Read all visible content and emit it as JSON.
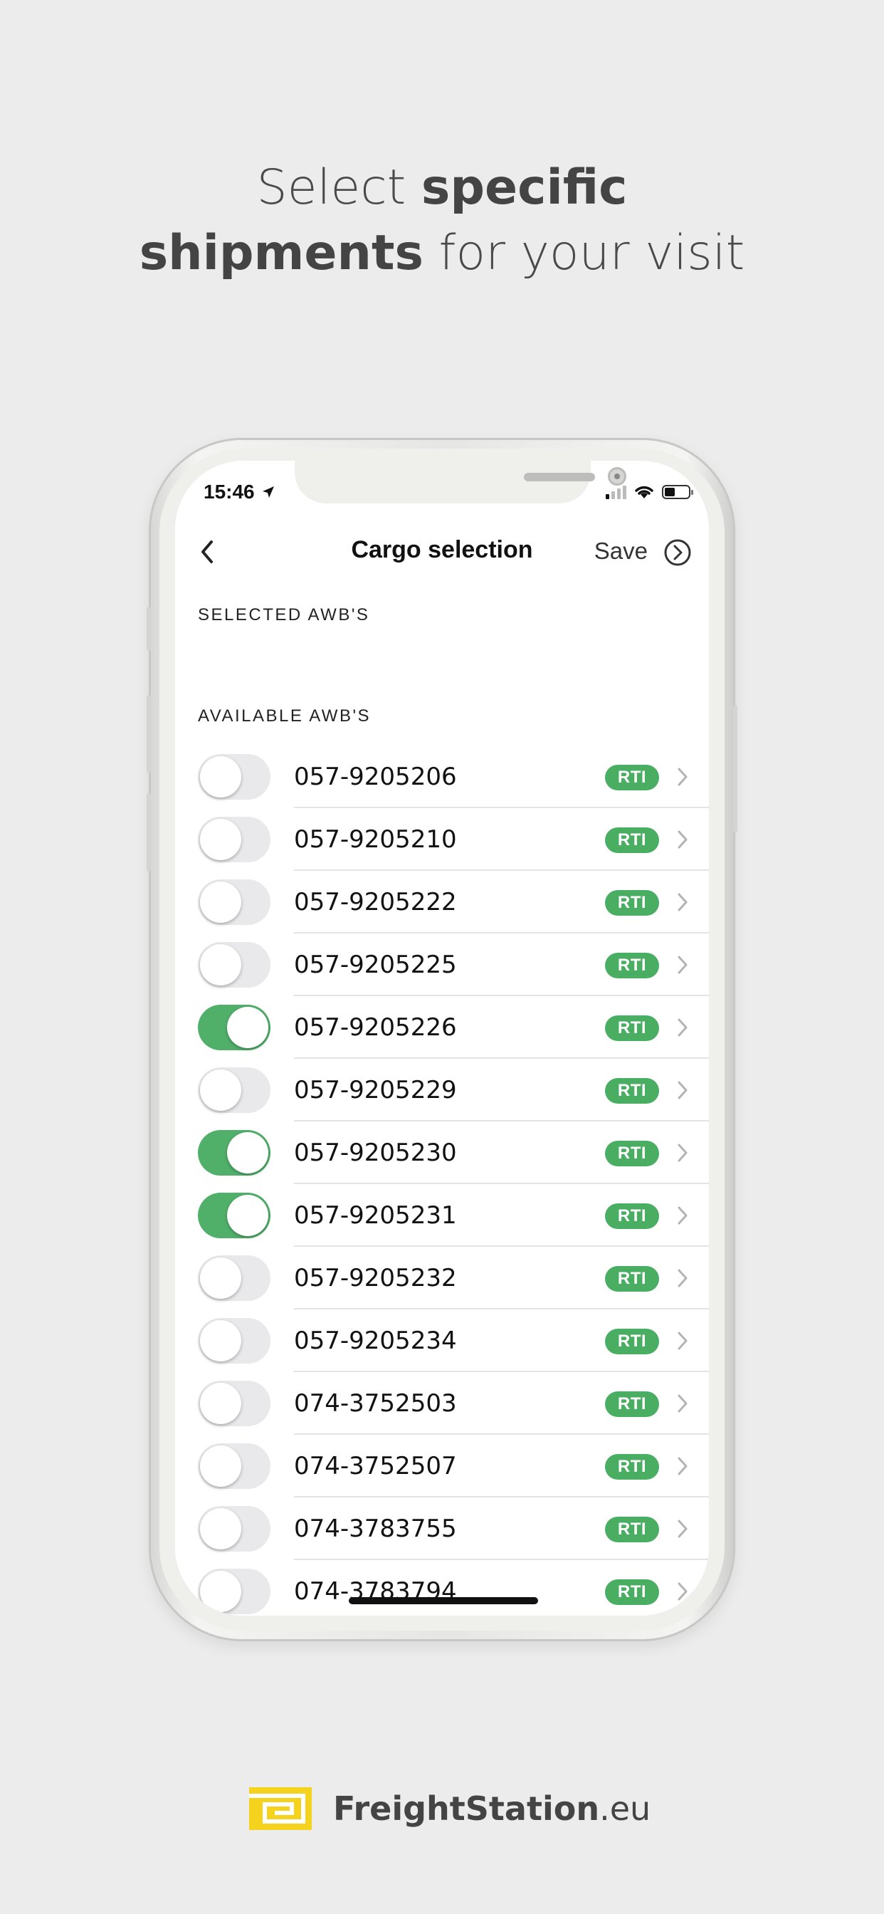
{
  "headline": {
    "part1": "Select ",
    "part2_bold": "specific",
    "part3_bold": "shipments",
    "part4": " for your visit"
  },
  "status_bar": {
    "time": "15:46"
  },
  "nav": {
    "title": "Cargo selection",
    "save_label": "Save"
  },
  "sections": {
    "selected_label": "SELECTED AWB'S",
    "available_label": "AVAILABLE AWB'S"
  },
  "awbs": [
    {
      "number": "057-9205206",
      "badge": "RTI",
      "selected": false
    },
    {
      "number": "057-9205210",
      "badge": "RTI",
      "selected": false
    },
    {
      "number": "057-9205222",
      "badge": "RTI",
      "selected": false
    },
    {
      "number": "057-9205225",
      "badge": "RTI",
      "selected": false
    },
    {
      "number": "057-9205226",
      "badge": "RTI",
      "selected": true
    },
    {
      "number": "057-9205229",
      "badge": "RTI",
      "selected": false
    },
    {
      "number": "057-9205230",
      "badge": "RTI",
      "selected": true
    },
    {
      "number": "057-9205231",
      "badge": "RTI",
      "selected": true
    },
    {
      "number": "057-9205232",
      "badge": "RTI",
      "selected": false
    },
    {
      "number": "057-9205234",
      "badge": "RTI",
      "selected": false
    },
    {
      "number": "074-3752503",
      "badge": "RTI",
      "selected": false
    },
    {
      "number": "074-3752507",
      "badge": "RTI",
      "selected": false
    },
    {
      "number": "074-3783755",
      "badge": "RTI",
      "selected": false
    },
    {
      "number": "074-3783794",
      "badge": "RTI",
      "selected": false
    }
  ],
  "brand": {
    "name": "FreightStation",
    "tld": ".eu",
    "logo_color": "#f5d21e"
  },
  "colors": {
    "toggle_on": "#50b06a",
    "badge": "#49ad62",
    "background": "#ececec"
  }
}
